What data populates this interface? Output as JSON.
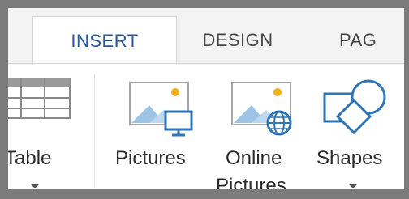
{
  "tabs": [
    {
      "label": "INSERT",
      "active": true
    },
    {
      "label": "DESIGN",
      "active": false
    },
    {
      "label": "PAG",
      "active": false
    }
  ],
  "commands": {
    "table": {
      "label": "Table",
      "icon": "table-icon"
    },
    "pictures": {
      "label": "Pictures",
      "icon": "pictures-icon"
    },
    "online_pictures": {
      "label_line1": "Online",
      "label_line2": "Pictures",
      "icon": "online-pictures-icon"
    },
    "shapes": {
      "label": "Shapes",
      "icon": "shapes-icon"
    }
  },
  "colors": {
    "accent": "#2b579a",
    "icon_blue": "#2e75b6",
    "icon_sun": "#f2b01e",
    "frame": "#7b7b7b"
  }
}
